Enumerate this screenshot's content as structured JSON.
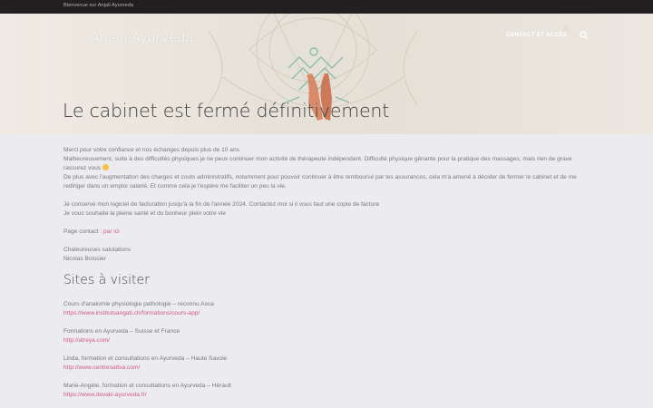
{
  "topbar": {
    "welcome": "Bienvenue sur Anjali Ayurveda"
  },
  "header": {
    "brand": "Anjali Ayurveda",
    "nav": [
      {
        "label": "CONTACT ET ACCÈS"
      }
    ],
    "search_icon": "search-icon"
  },
  "hero": {
    "title": "Le cabinet est fermé définitivement"
  },
  "body": {
    "p1": "Merci pour votre confiance et nos échanges depuis plus de 10 ans",
    "p2": "Malheureusement, suite à des difficultés physiques je ne peux continuer mon activité de thérapeute indépendant. Difficulté physique gênante pour la pratique des massages, mais rien de grave rassurez vous",
    "p3": "De plus avec l'augmentation des charges et couts administratifs, notamment pour pouvoir continuer à être remboursé par les assurances, cela m'a amené à décider de fermer le cabinet et de me rediriger dans un emploi salarié. Et comme cela je l'espère me faciliter un peu la vie.",
    "p4": "Je conserve mon logiciel de facturation jusqu'à la fin de l'année 2024. Contactez moi si il vous faut une copie de facture",
    "p5": "Je vous souhaite la pleine santé et du bonheur plein votre vie",
    "contact_label": "Page contact : ",
    "contact_link": "par ici",
    "closing": "Chaleureuses salutations",
    "signature": "Nicolas Boissier"
  },
  "sites": {
    "heading": "Sites à visiter",
    "items": [
      {
        "desc": "Cours d'anatomie physiologie pathologie – reconnu Asca",
        "url": "https://www.institutsangati.ch/formations/cours-app/"
      },
      {
        "desc": "Formations en Ayurveda – Suisse et France",
        "url": "http://atreya.com/"
      },
      {
        "desc": "Linda, formation et consultations en Ayurveda – Haute Savoie",
        "url": "http://www.centresattva.com/"
      },
      {
        "desc": "Marie-Angèle, formation et consultations en Ayurveda – Hérault",
        "url": "https://www.devaki-ayurveda.fr/"
      }
    ]
  },
  "colors": {
    "topbar": "#231f20",
    "link": "#d45b7e",
    "background": "#ebebf0",
    "text": "#7a7a7a",
    "heading": "#3d3d3d"
  }
}
